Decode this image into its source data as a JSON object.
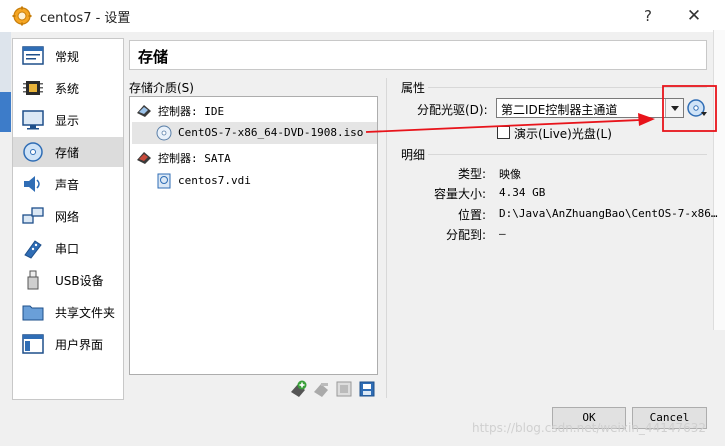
{
  "window": {
    "title": "centos7 - 设置",
    "help_label": "?",
    "close_label": "✕"
  },
  "sidebar": {
    "items": [
      {
        "label": "常规",
        "icon": "general-icon"
      },
      {
        "label": "系统",
        "icon": "system-chip-icon"
      },
      {
        "label": "显示",
        "icon": "display-monitor-icon"
      },
      {
        "label": "存储",
        "icon": "storage-disc-icon",
        "selected": true
      },
      {
        "label": "声音",
        "icon": "speaker-icon"
      },
      {
        "label": "网络",
        "icon": "network-icon"
      },
      {
        "label": "串口",
        "icon": "serial-port-icon"
      },
      {
        "label": "USB设备",
        "icon": "usb-icon"
      },
      {
        "label": "共享文件夹",
        "icon": "shared-folder-icon"
      },
      {
        "label": "用户界面",
        "icon": "user-interface-icon"
      }
    ]
  },
  "page": {
    "title": "存储"
  },
  "storage": {
    "label": "存储介质(S)",
    "tree": [
      {
        "label": "控制器: IDE",
        "type": "controller"
      },
      {
        "label": "CentOS-7-x86_64-DVD-1908.iso",
        "type": "optical",
        "selected": true
      },
      {
        "label": "控制器: SATA",
        "type": "controller"
      },
      {
        "label": "centos7.vdi",
        "type": "disk"
      }
    ],
    "toolbar": [
      "add-attachment-icon",
      "remove-attachment-icon",
      "add-controller-icon",
      "remove-controller-icon"
    ]
  },
  "attributes": {
    "heading": "属性",
    "drive_label": "分配光驱(D):",
    "drive_value": "第二IDE控制器主通道",
    "live_cd_label": "演示(Live)光盘(L)",
    "live_cd_checked": false
  },
  "details": {
    "heading": "明细",
    "rows": [
      {
        "key": "类型:",
        "value": "映像"
      },
      {
        "key": "容量大小:",
        "value": "4.34  GB"
      },
      {
        "key": "位置:",
        "value": "D:\\Java\\AnZhuangBao\\CentOS-7-x86…"
      },
      {
        "key": "分配到:",
        "value": "—"
      }
    ]
  },
  "buttons": {
    "ok": "OK",
    "cancel": "Cancel"
  },
  "watermark": "https://blog.csdn.net/weixin_44147632",
  "colors": {
    "annotation_red": "#e8141b",
    "selection_bg": "#dcdcdc"
  }
}
